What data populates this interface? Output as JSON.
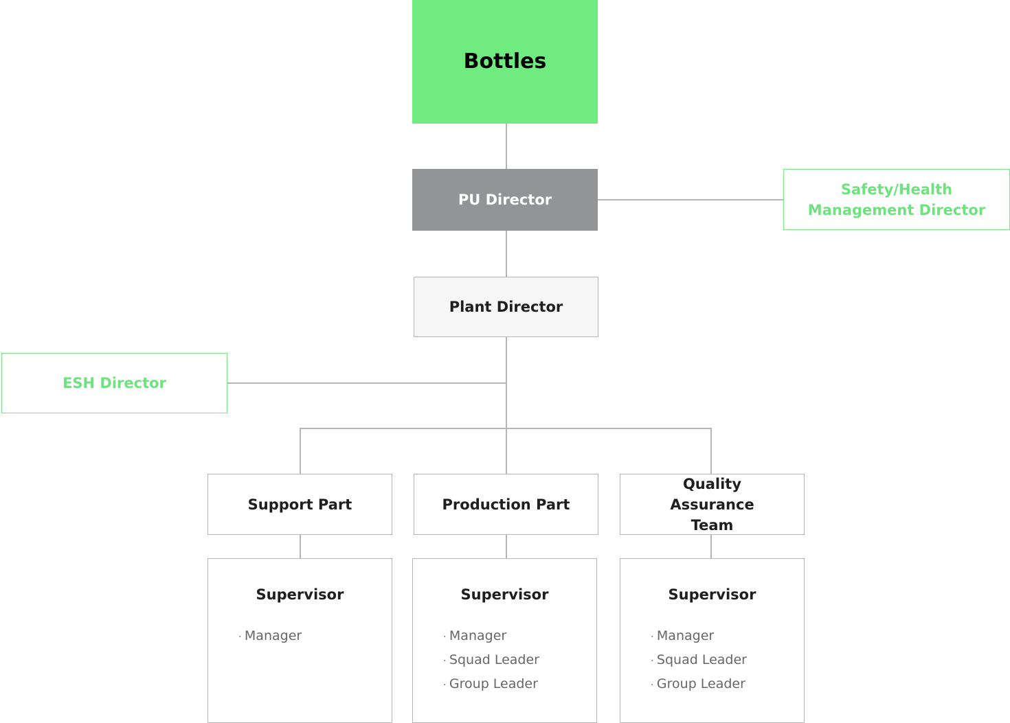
{
  "root": "Bottles",
  "pu_director": "PU Director",
  "safety_director": "Safety/Health Management Director",
  "plant_director": "Plant Director",
  "esh_director": "ESH Director",
  "parts": [
    {
      "name": "Support Part",
      "supervisor": "Supervisor",
      "roles": [
        "Manager"
      ]
    },
    {
      "name": "Production Part",
      "supervisor": "Supervisor",
      "roles": [
        "Manager",
        "Squad Leader",
        "Group Leader"
      ]
    },
    {
      "name": "Quality Assurance Team",
      "supervisor": "Supervisor",
      "roles": [
        "Manager",
        "Squad Leader",
        "Group Leader"
      ]
    }
  ],
  "colors": {
    "accent": "#6feb80",
    "pu": "#939496",
    "plant": "#f6f6f6",
    "line": "#b5b5b5"
  }
}
